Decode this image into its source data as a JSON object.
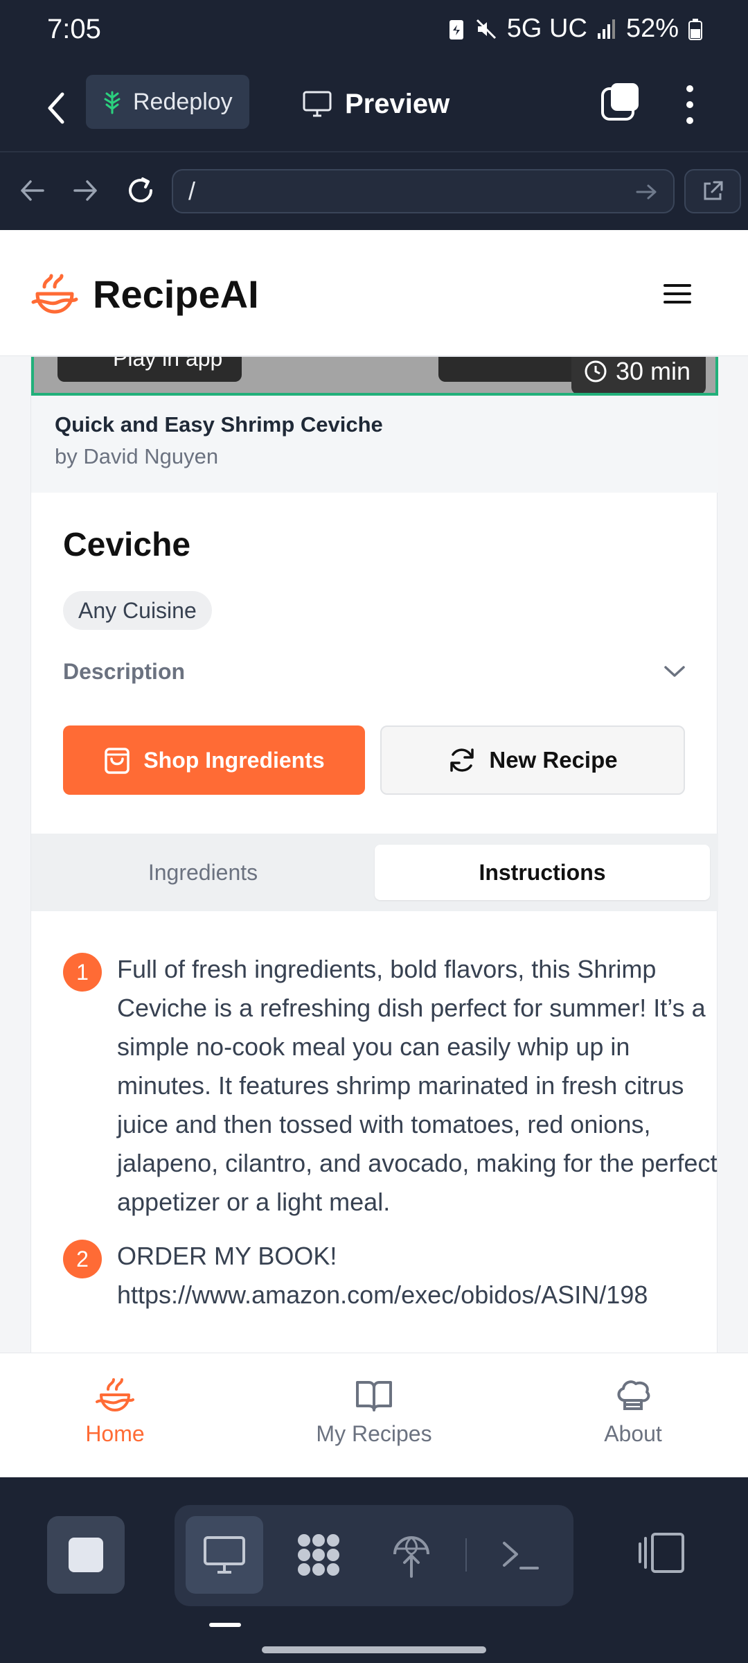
{
  "status": {
    "time": "7:05",
    "network": "5G UC",
    "battery": "52%"
  },
  "toolbar": {
    "redeploy_label": "Redeploy",
    "preview_label": "Preview"
  },
  "urlbar": {
    "url": "/"
  },
  "site": {
    "brand": "RecipeAI"
  },
  "video": {
    "pill_text": "Play in app",
    "duration": "30 min",
    "title": "Quick and Easy Shrimp Ceviche",
    "author": "by David Nguyen"
  },
  "recipe": {
    "title": "Ceviche",
    "cuisine": "Any Cuisine",
    "description_label": "Description",
    "shop_label": "Shop Ingredients",
    "new_label": "New Recipe"
  },
  "tabs": {
    "ingredients": "Ingredients",
    "instructions": "Instructions"
  },
  "steps": [
    {
      "num": "1",
      "text": "Full of fresh ingredients, bold flavors, this Shrimp Ceviche is a refreshing dish perfect for summer! It’s a simple no-cook meal you can easily whip up in minutes. It features shrimp marinated in fresh citrus juice and then tossed with tomatoes, red onions, jalapeno, cilantro, and avocado, making for the perfect appetizer or a light meal."
    },
    {
      "num": "2",
      "text": "ORDER MY BOOK!",
      "text2": "https://www.amazon.com/exec/obidos/ASIN/198"
    }
  ],
  "bottomnav": {
    "home": "Home",
    "my_recipes": "My Recipes",
    "about": "About"
  },
  "colors": {
    "accent": "#ff6b35",
    "chrome": "#1c2333",
    "video_border": "#21b07a"
  }
}
